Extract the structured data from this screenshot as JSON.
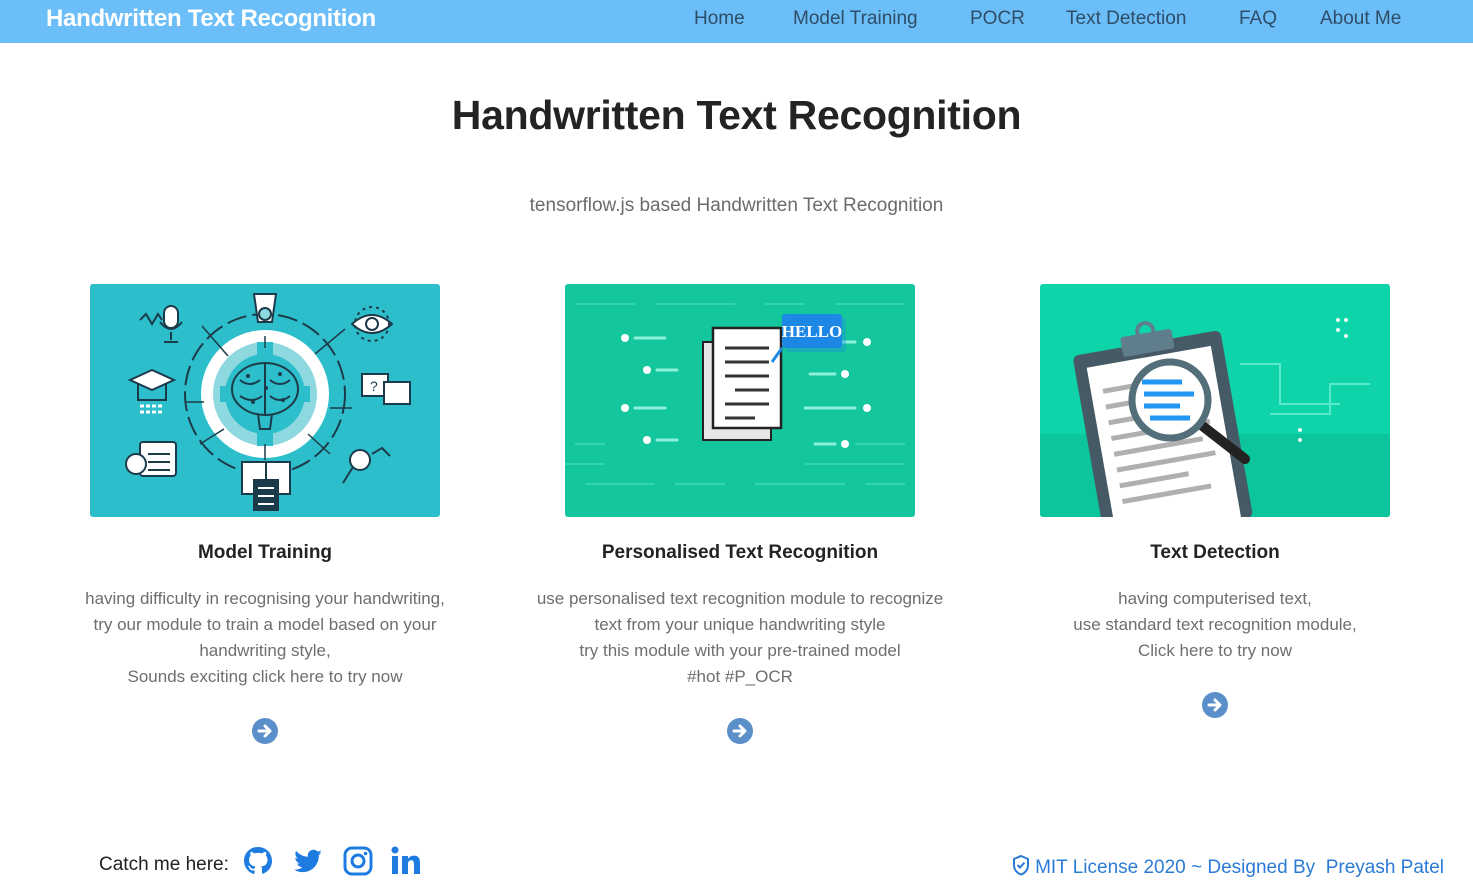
{
  "nav": {
    "brand": "Handwritten Text Recognition",
    "links": [
      "Home",
      "Model Training",
      "POCR",
      "Text Detection",
      "FAQ",
      "About Me"
    ]
  },
  "hero": {
    "title": "Handwritten Text Recognition",
    "subtitle": "tensorflow.js based Handwritten Text Recognition"
  },
  "cards": [
    {
      "title": "Model Training",
      "lines": [
        "having difficulty in recognising your handwriting,",
        "try our module to train a model based on your",
        "handwriting style,",
        "Sounds exciting click here to try now"
      ],
      "image_label": "",
      "arrow_icon": "arrow-circle-right-icon"
    },
    {
      "title": "Personalised Text Recognition",
      "lines": [
        "use personalised text recognition module to recognize",
        "text from your unique handwriting style",
        "try this module with your pre-trained model",
        "#hot #P_OCR"
      ],
      "image_label": "HELLO",
      "arrow_icon": "arrow-circle-right-icon"
    },
    {
      "title": "Text Detection",
      "lines": [
        "having computerised text,",
        "use standard text recognition module,",
        "Click here to try now"
      ],
      "image_label": "",
      "arrow_icon": "arrow-circle-right-icon"
    }
  ],
  "footer": {
    "catch_label": "Catch me here:",
    "social_icons": [
      "github-icon",
      "twitter-icon",
      "instagram-icon",
      "linkedin-icon"
    ],
    "license_text": "MIT License 2020 ~ Designed By",
    "designer": "Preyash Patel"
  },
  "colors": {
    "navbar": "#6cbef8",
    "accent_blue": "#2b7bd6",
    "arrow": "#5b8fc9",
    "card1_bg": "#2dbecb",
    "card2_bg": "#14c69b",
    "card3_bg": "#0fd3a9"
  }
}
